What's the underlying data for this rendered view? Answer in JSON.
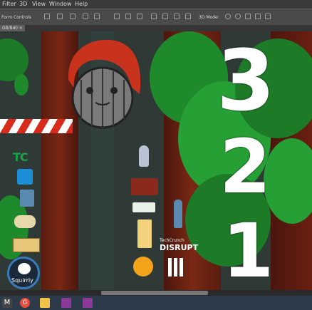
{
  "menu": [
    "Filter",
    "3D",
    "View",
    "Window",
    "Help"
  ],
  "options": {
    "form_controls": "Form Controls",
    "mode_3d": "3D Mode:"
  },
  "doc_tab": "GB/8#)",
  "countdown": [
    "3",
    "2",
    "1"
  ],
  "badges": {
    "squirrly": "Squirrly",
    "techcrunch_small": "TechCrunch",
    "disrupt": "DISRUPT",
    "tc_logo": "TC"
  },
  "colors": {
    "tc_green": "#16a34a",
    "canvas_bg": "#2f3a37",
    "foliage": "#1f8a2b",
    "trunk_red": "#6b1f12"
  },
  "taskbar": [
    "M",
    "G",
    "folder",
    "app-1",
    "app-2"
  ]
}
